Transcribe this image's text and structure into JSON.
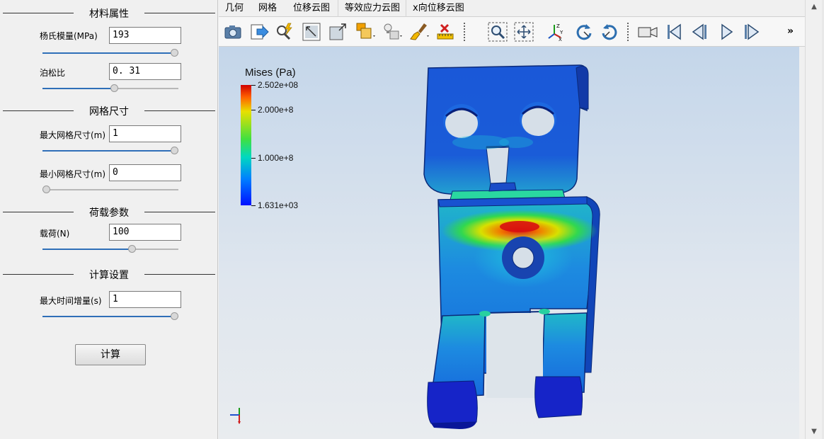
{
  "panel": {
    "groups": [
      {
        "title": "材料属性"
      },
      {
        "title": "网格尺寸"
      },
      {
        "title": "荷载参数"
      },
      {
        "title": "计算设置"
      }
    ],
    "params": [
      {
        "label": "杨氏模量(MPa)",
        "value": "193",
        "slider_fraction": 1.0
      },
      {
        "label": "泊松比",
        "value": "0. 31",
        "slider_fraction": 0.53
      },
      {
        "label": "最大网格尺寸(m)",
        "value": "1",
        "slider_fraction": 1.0
      },
      {
        "label": "最小网格尺寸(m)",
        "value": "0",
        "slider_fraction": 0.0
      },
      {
        "label": "载荷(N)",
        "value": "100",
        "slider_fraction": 0.67
      },
      {
        "label": "最大时间增量(s)",
        "value": "1",
        "slider_fraction": 1.0
      }
    ],
    "calc_button": "计算"
  },
  "tabs": [
    "几何",
    "网格",
    "位移云图",
    "等效应力云图",
    "x向位移云图"
  ],
  "toolbar": {
    "icons": [
      "camera-icon",
      "export-arrow-icon",
      "zoom-lightning-icon",
      "fit-window-icon",
      "maximize-icon",
      "box-select-icon",
      "light-bulb-icon",
      "brush-icon",
      "ruler-icon",
      "zoom-box-icon",
      "move-icon",
      "axis-orient-icon",
      "rotate-cw-icon",
      "rotate-ccw-icon",
      "video-camera-icon",
      "first-frame-icon",
      "prev-frame-icon",
      "play-icon",
      "next-frame-icon"
    ],
    "overflow": "»"
  },
  "legend": {
    "title": "Mises (Pa)",
    "ticks": [
      "2.502e+08",
      "2.000e+8",
      "1.000e+8",
      "1.631e+03"
    ],
    "colors": {
      "max": "#d00000",
      "mid": "#40e040",
      "min": "#0010ff"
    }
  },
  "scrollbar": {
    "up": "▲",
    "down": "▼"
  }
}
